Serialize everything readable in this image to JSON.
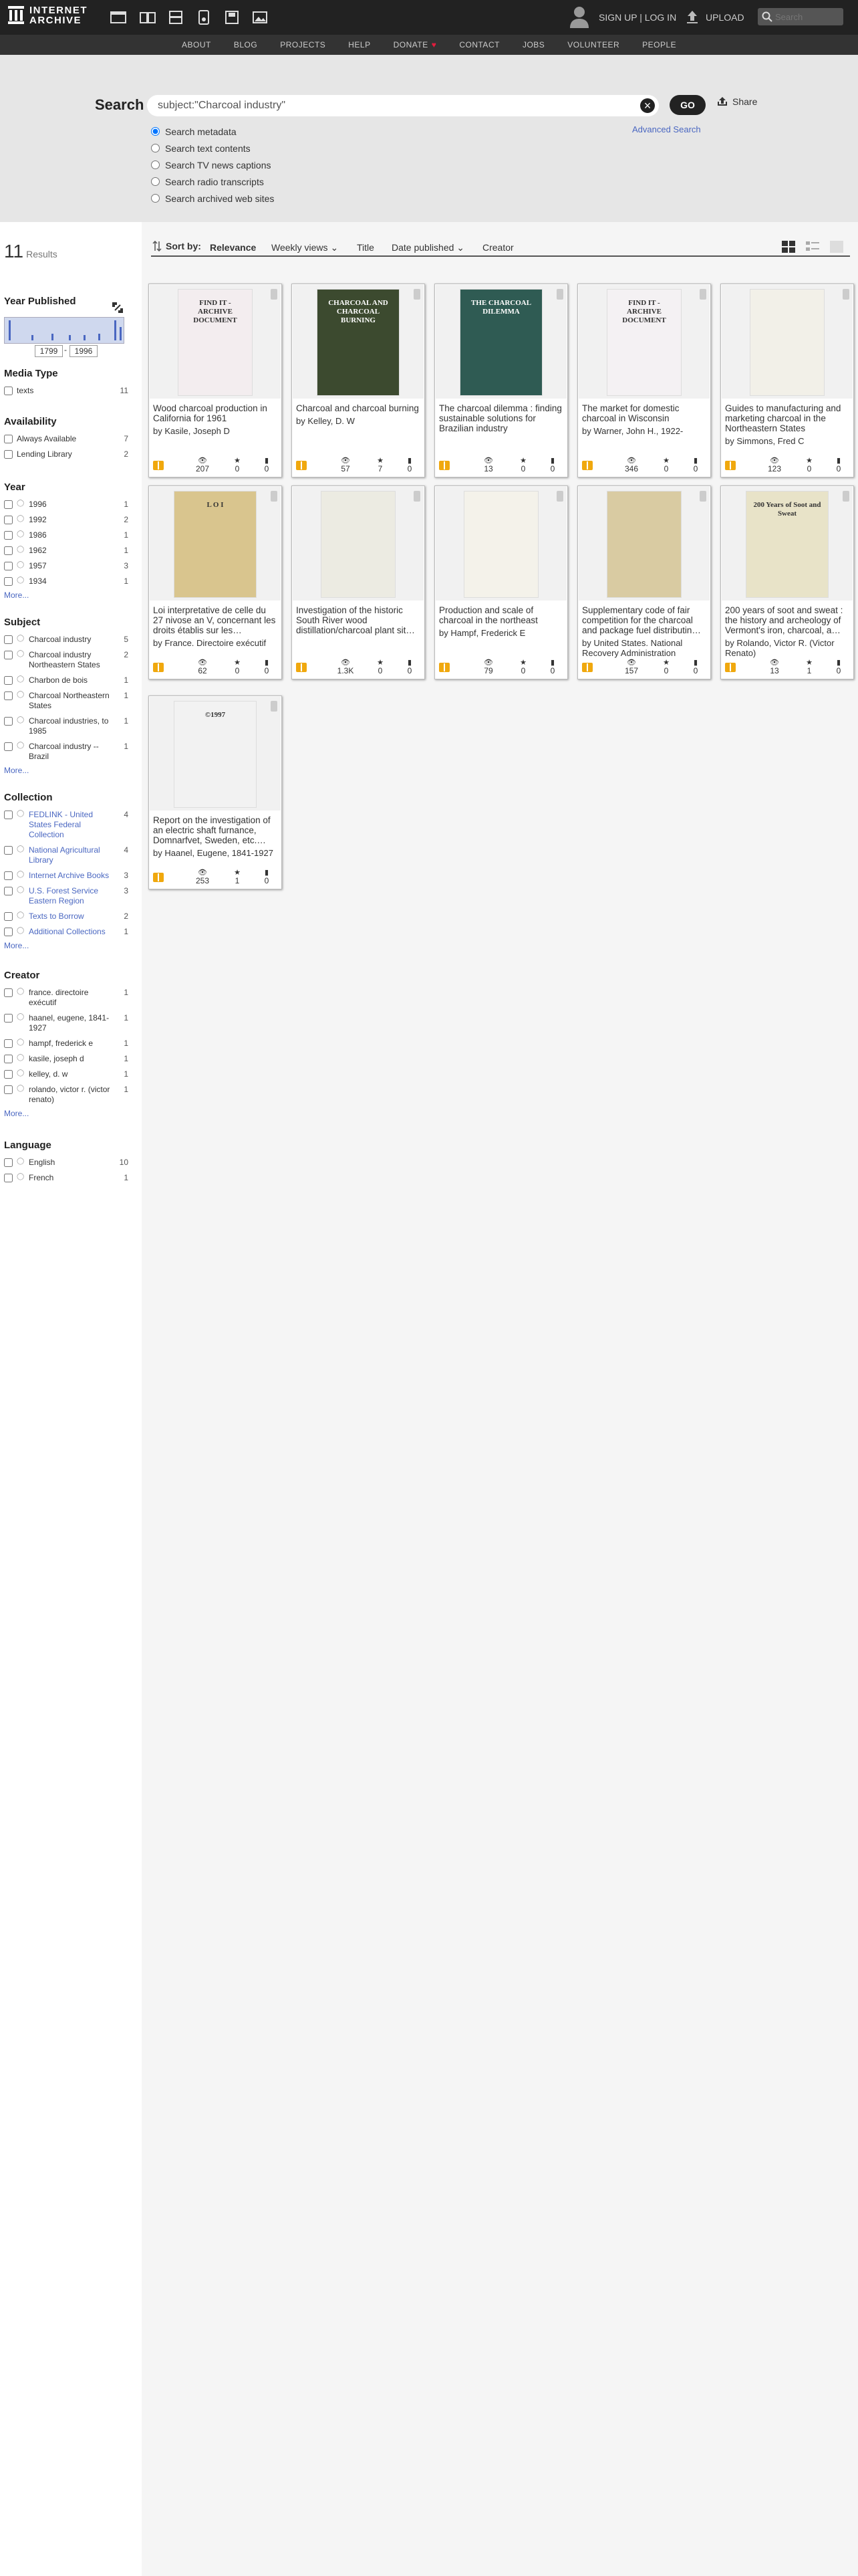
{
  "header": {
    "logo_line1": "INTERNET",
    "logo_line2": "ARCHIVE",
    "signup": "SIGN UP | LOG IN",
    "upload": "UPLOAD",
    "search_placeholder": "Search",
    "media_icons": [
      "web-icon",
      "texts-icon",
      "video-icon",
      "audio-icon",
      "software-icon",
      "images-icon"
    ]
  },
  "nav": {
    "items": [
      "ABOUT",
      "BLOG",
      "PROJECTS",
      "HELP",
      "DONATE",
      "CONTACT",
      "JOBS",
      "VOLUNTEER",
      "PEOPLE"
    ]
  },
  "search": {
    "label": "Search",
    "query": "subject:\"Charcoal industry\"",
    "go": "GO",
    "share": "Share",
    "advanced": "Advanced Search",
    "options": [
      {
        "label": "Search metadata",
        "checked": true
      },
      {
        "label": "Search text contents",
        "checked": false
      },
      {
        "label": "Search TV news captions",
        "checked": false
      },
      {
        "label": "Search radio transcripts",
        "checked": false
      },
      {
        "label": "Search archived web sites",
        "checked": false
      }
    ]
  },
  "results": {
    "count": "11",
    "label": "Results"
  },
  "facets": {
    "year_published": {
      "title": "Year Published",
      "from": "1799",
      "to": "1996"
    },
    "media_type": {
      "title": "Media Type",
      "items": [
        {
          "label": "texts",
          "count": "11"
        }
      ]
    },
    "availability": {
      "title": "Availability",
      "items": [
        {
          "label": "Always Available",
          "count": "7"
        },
        {
          "label": "Lending Library",
          "count": "2"
        }
      ]
    },
    "year": {
      "title": "Year",
      "items": [
        {
          "label": "1996",
          "count": "1"
        },
        {
          "label": "1992",
          "count": "2"
        },
        {
          "label": "1986",
          "count": "1"
        },
        {
          "label": "1962",
          "count": "1"
        },
        {
          "label": "1957",
          "count": "3"
        },
        {
          "label": "1934",
          "count": "1"
        }
      ],
      "more": "More..."
    },
    "subject": {
      "title": "Subject",
      "items": [
        {
          "label": "Charcoal industry",
          "count": "5"
        },
        {
          "label": "Charcoal industry Northeastern States",
          "count": "2"
        },
        {
          "label": "Charbon de bois",
          "count": "1"
        },
        {
          "label": "Charcoal Northeastern States",
          "count": "1"
        },
        {
          "label": "Charcoal industries, to 1985",
          "count": "1"
        },
        {
          "label": "Charcoal industry -- Brazil",
          "count": "1"
        }
      ],
      "more": "More..."
    },
    "collection": {
      "title": "Collection",
      "items": [
        {
          "label": "FEDLINK - United States Federal Collection",
          "count": "4"
        },
        {
          "label": "National Agricultural Library",
          "count": "4"
        },
        {
          "label": "Internet Archive Books",
          "count": "3"
        },
        {
          "label": "U.S. Forest Service Eastern Region",
          "count": "3"
        },
        {
          "label": "Texts to Borrow",
          "count": "2"
        },
        {
          "label": "Additional Collections",
          "count": "1"
        }
      ],
      "more": "More..."
    },
    "creator": {
      "title": "Creator",
      "items": [
        {
          "label": "france. directoire exécutif",
          "count": "1"
        },
        {
          "label": "haanel, eugene, 1841-1927",
          "count": "1"
        },
        {
          "label": "hampf, frederick e",
          "count": "1"
        },
        {
          "label": "kasile, joseph d",
          "count": "1"
        },
        {
          "label": "kelley, d. w",
          "count": "1"
        },
        {
          "label": "rolando, victor r. (victor renato)",
          "count": "1"
        }
      ],
      "more": "More..."
    },
    "language": {
      "title": "Language",
      "items": [
        {
          "label": "English",
          "count": "10"
        },
        {
          "label": "French",
          "count": "1"
        }
      ]
    }
  },
  "sort": {
    "label": "Sort by:",
    "options": [
      "Relevance",
      "Weekly views",
      "Title",
      "Date published",
      "Creator"
    ]
  },
  "tiles": [
    {
      "title": "Wood charcoal production in California for 1961",
      "by": "by Kasile, Joseph D",
      "views": "207",
      "favs": "0",
      "reviews": "0",
      "cover_bg": "#f3edef",
      "cover_text": "FIND IT - ARCHIVE DOCUMENT"
    },
    {
      "title": "Charcoal and charcoal burning",
      "by": "by Kelley, D. W",
      "views": "57",
      "favs": "7",
      "reviews": "0",
      "cover_bg": "#3c4a2f",
      "cover_text": "CHARCOAL AND CHARCOAL BURNING"
    },
    {
      "title": "The charcoal dilemma : finding sustainable solutions for Brazilian industry",
      "by": "",
      "views": "13",
      "favs": "0",
      "reviews": "0",
      "cover_bg": "#2f5b53",
      "cover_text": "THE CHARCOAL DILEMMA"
    },
    {
      "title": "The market for domestic charcoal in Wisconsin",
      "by": "by Warner, John H., 1922-",
      "views": "346",
      "favs": "0",
      "reviews": "0",
      "cover_bg": "#f4f1f3",
      "cover_text": "FIND IT - ARCHIVE DOCUMENT"
    },
    {
      "title": "Guides to manufacturing and marketing charcoal in the Northeastern States",
      "by": "by Simmons, Fred C",
      "views": "123",
      "favs": "0",
      "reviews": "0",
      "cover_bg": "#f2f0e8",
      "cover_text": ""
    },
    {
      "title": "Loi interpretative de celle du 27 nivose an V, concernant les droits établis sur les…",
      "by": "by France. Directoire exécutif",
      "views": "62",
      "favs": "0",
      "reviews": "0",
      "cover_bg": "#d9c58e",
      "cover_text": "L O I"
    },
    {
      "title": "Investigation of the historic South River wood distillation/charcoal plant sit…",
      "by": "",
      "views": "1.3K",
      "favs": "0",
      "reviews": "0",
      "cover_bg": "#ecebe2",
      "cover_text": ""
    },
    {
      "title": "Production and scale of charcoal in the northeast",
      "by": "by Hampf, Frederick E",
      "views": "79",
      "favs": "0",
      "reviews": "0",
      "cover_bg": "#f4f2ea",
      "cover_text": ""
    },
    {
      "title": "Supplementary code of fair competition for the charcoal and package fuel distributin…",
      "by": "by United States. National Recovery Administration",
      "views": "157",
      "favs": "0",
      "reviews": "0",
      "cover_bg": "#d9cba2",
      "cover_text": ""
    },
    {
      "title": "200 years of soot and sweat : the history and archeology of Vermont's iron, charcoal, a…",
      "by": "by Rolando, Victor R. (Victor Renato)",
      "views": "13",
      "favs": "1",
      "reviews": "0",
      "cover_bg": "#e8e3c8",
      "cover_text": "200 Years of Soot and Sweat"
    },
    {
      "title": "Report on the investigation of an electric shaft furnance, Domnarfvet, Sweden, etc.…",
      "by": "by Haanel, Eugene, 1841-1927",
      "views": "253",
      "favs": "1",
      "reviews": "0",
      "cover_bg": "#f2f2f2",
      "cover_text": "©1997"
    }
  ]
}
